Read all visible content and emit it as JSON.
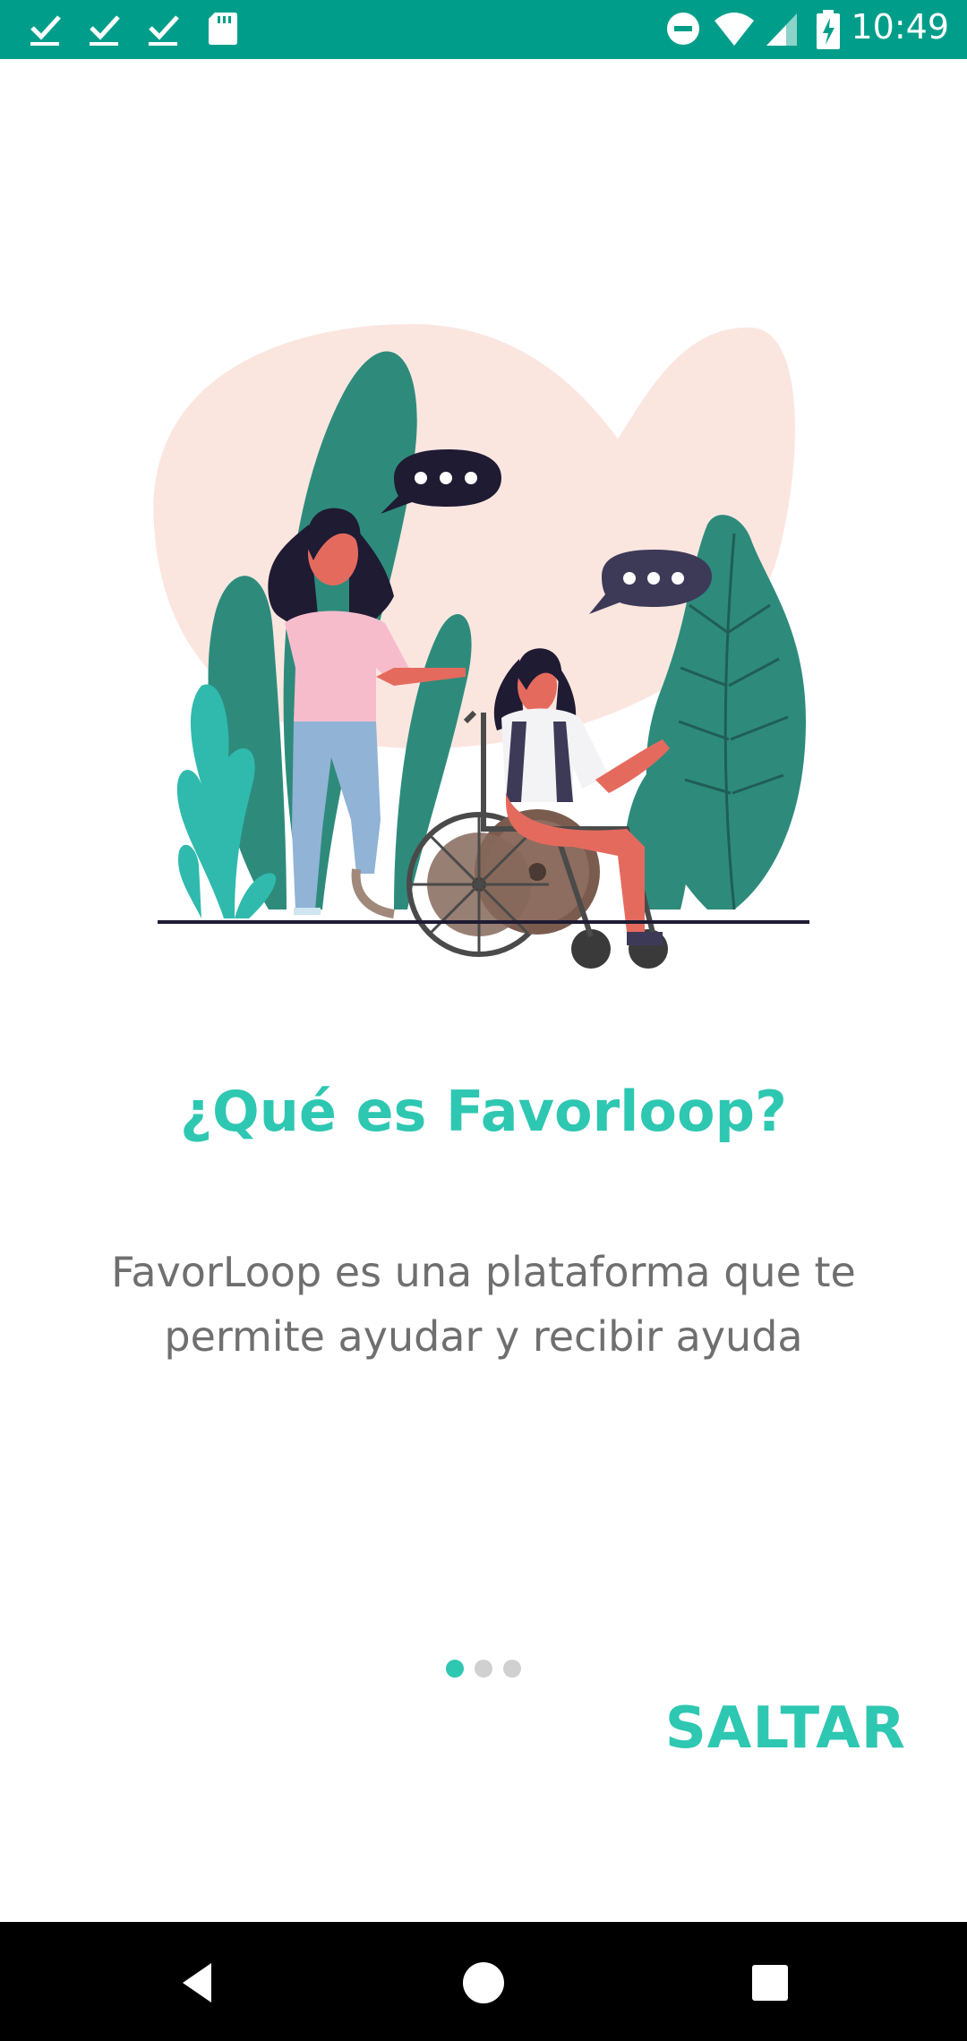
{
  "status_bar": {
    "time": "10:49",
    "left_icons": [
      "check-icon",
      "check-icon",
      "check-icon",
      "sd-card-icon"
    ],
    "right_icons": [
      "do-not-disturb-icon",
      "wifi-icon",
      "signal-icon",
      "battery-charging-icon"
    ]
  },
  "onboarding": {
    "title": "¿Qué es Favorloop?",
    "description": "FavorLoop es una plataforma que te permite ayudar y recibir ayuda",
    "page_indicator": {
      "current": 1,
      "total": 3
    },
    "skip_label": "SALTAR"
  },
  "colors": {
    "status_bar": "#009e8a",
    "accent": "#2ec7b2",
    "text_secondary": "#6f6f6f",
    "dot_inactive": "#d0d0d0",
    "nav_bar": "#000000"
  },
  "nav_bar": {
    "buttons": [
      "back-icon",
      "home-icon",
      "recents-icon"
    ]
  }
}
